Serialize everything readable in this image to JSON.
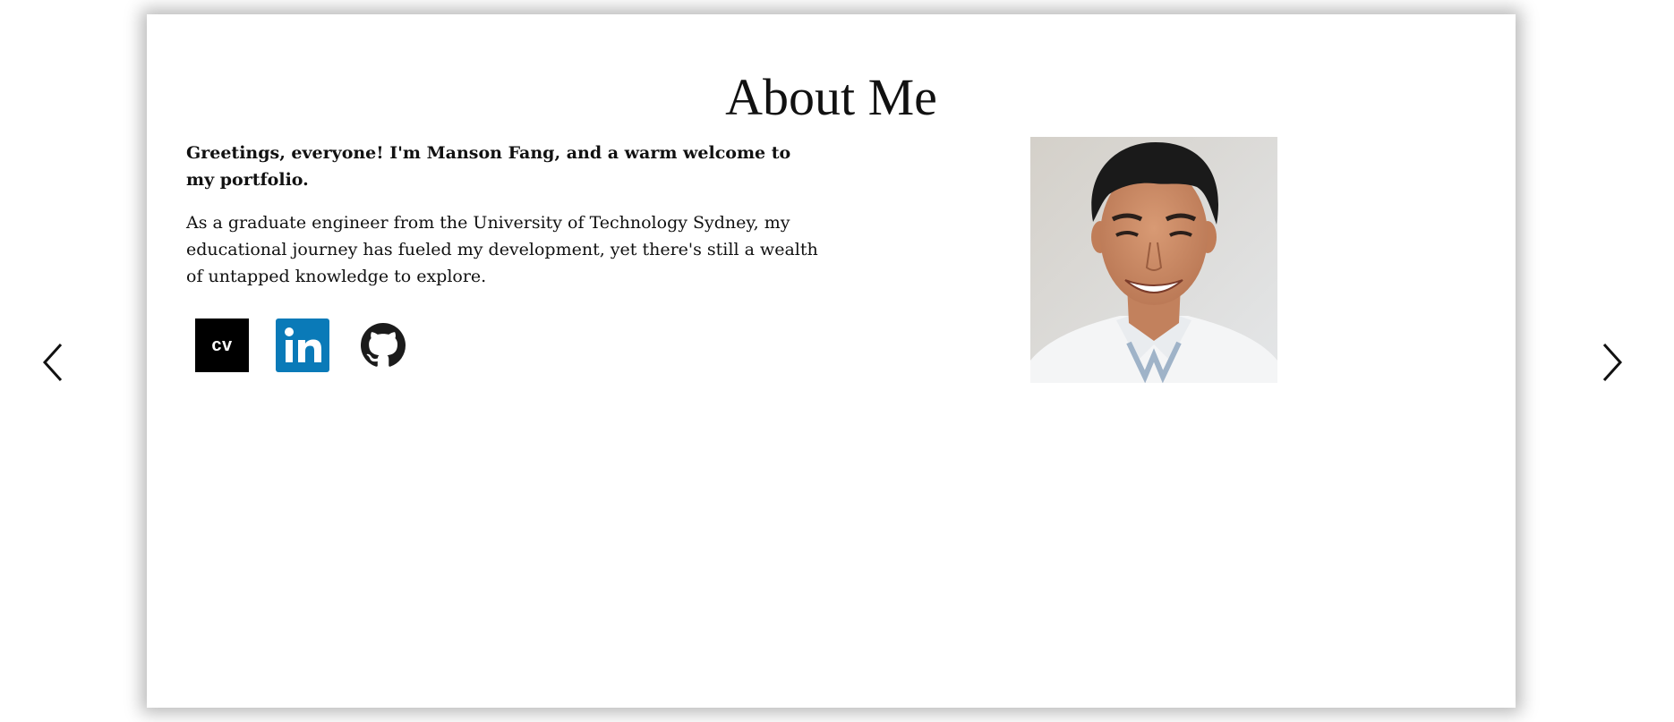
{
  "page": {
    "title": "About Me"
  },
  "intro": {
    "greeting": "Greetings, everyone! I'm Manson Fang, and a warm welcome to my portfolio.",
    "bio": "As a graduate engineer from the University of Technology Sydney, my educational journey has fueled my development, yet there's still a wealth of untapped knowledge to explore."
  },
  "links": {
    "cv_label": "cv",
    "linkedin_icon": "linkedin-icon",
    "github_icon": "github-icon"
  },
  "navigation": {
    "prev_icon": "chevron-left-icon",
    "next_icon": "chevron-right-icon"
  },
  "profile_photo": {
    "description": "profile-photo"
  },
  "colors": {
    "card_background": "#ffffff",
    "text": "#111111",
    "cv_background": "#000000",
    "linkedin_blue": "#0a7ab8",
    "github": "#1b1b1b"
  }
}
